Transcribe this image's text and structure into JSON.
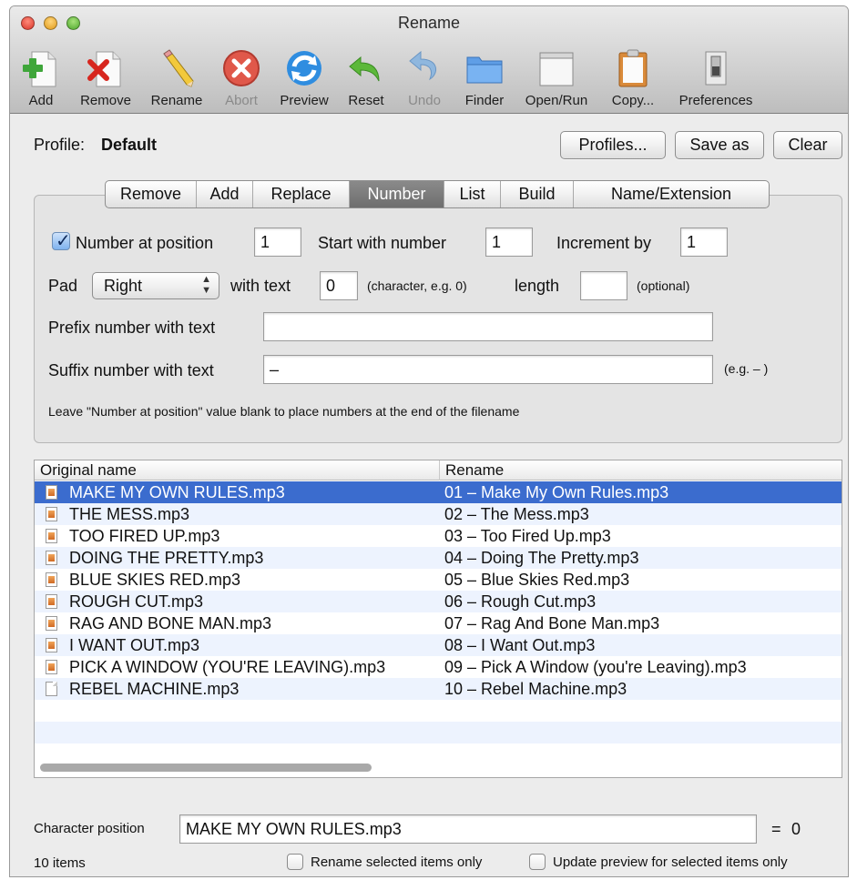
{
  "window": {
    "title": "Rename"
  },
  "toolbar": {
    "items": [
      {
        "label": "Add",
        "icon": "add-icon",
        "enabled": true
      },
      {
        "label": "Remove",
        "icon": "remove-icon",
        "enabled": true
      },
      {
        "label": "Rename",
        "icon": "pencil-icon",
        "enabled": true
      },
      {
        "label": "Abort",
        "icon": "abort-icon",
        "enabled": false
      },
      {
        "label": "Preview",
        "icon": "refresh-icon",
        "enabled": true
      },
      {
        "label": "Reset",
        "icon": "reset-arrow-icon",
        "enabled": true
      },
      {
        "label": "Undo",
        "icon": "undo-arrow-icon",
        "enabled": false
      },
      {
        "label": "Finder",
        "icon": "folder-icon",
        "enabled": true
      },
      {
        "label": "Open/Run",
        "icon": "window-icon",
        "enabled": true
      },
      {
        "label": "Copy...",
        "icon": "clipboard-icon",
        "enabled": true
      },
      {
        "label": "Preferences",
        "icon": "switch-icon",
        "enabled": true
      }
    ]
  },
  "profile": {
    "label": "Profile:",
    "name": "Default",
    "buttons": {
      "profiles": "Profiles...",
      "save_as": "Save as",
      "clear": "Clear"
    }
  },
  "tabs": [
    {
      "label": "Remove",
      "active": false
    },
    {
      "label": "Add",
      "active": false
    },
    {
      "label": "Replace",
      "active": false
    },
    {
      "label": "Number",
      "active": true
    },
    {
      "label": "List",
      "active": false
    },
    {
      "label": "Build",
      "active": false
    },
    {
      "label": "Name/Extension",
      "active": false
    }
  ],
  "number_tab": {
    "number_at_position": {
      "label": "Number at position",
      "checked": true,
      "value": "1"
    },
    "start_with": {
      "label": "Start with number",
      "value": "1"
    },
    "increment_by": {
      "label": "Increment by",
      "value": "1"
    },
    "pad": {
      "label": "Pad",
      "value": "Right"
    },
    "with_text": {
      "label": "with text",
      "value": "0",
      "hint": "(character, e.g. 0)"
    },
    "length": {
      "label": "length",
      "value": "",
      "hint": "(optional)"
    },
    "prefix": {
      "label": "Prefix number with text",
      "value": ""
    },
    "suffix": {
      "label": "Suffix number with text",
      "value": "–",
      "hint": "(e.g. – )"
    },
    "note": "Leave \"Number at position\" value blank to place numbers at the end of the filename"
  },
  "table": {
    "columns": [
      "Original name",
      "Rename"
    ],
    "rows": [
      {
        "original": "MAKE MY OWN RULES.mp3",
        "rename": "01 – Make My Own Rules.mp3",
        "icon": "mp3"
      },
      {
        "original": "THE MESS.mp3",
        "rename": "02 – The Mess.mp3",
        "icon": "mp3"
      },
      {
        "original": "TOO FIRED UP.mp3",
        "rename": "03 – Too Fired Up.mp3",
        "icon": "mp3"
      },
      {
        "original": "DOING THE PRETTY.mp3",
        "rename": "04 – Doing The Pretty.mp3",
        "icon": "mp3"
      },
      {
        "original": "BLUE SKIES RED.mp3",
        "rename": "05 – Blue Skies Red.mp3",
        "icon": "mp3"
      },
      {
        "original": "ROUGH CUT.mp3",
        "rename": "06 – Rough Cut.mp3",
        "icon": "mp3"
      },
      {
        "original": "RAG AND BONE MAN.mp3",
        "rename": "07 – Rag And Bone Man.mp3",
        "icon": "mp3"
      },
      {
        "original": "I WANT OUT.mp3",
        "rename": "08 – I Want Out.mp3",
        "icon": "mp3"
      },
      {
        "original": "PICK A WINDOW (YOU'RE LEAVING).mp3",
        "rename": "09 – Pick A Window (you're Leaving).mp3",
        "icon": "mp3"
      },
      {
        "original": "REBEL MACHINE.mp3",
        "rename": "10 – Rebel Machine.mp3",
        "icon": "plain"
      }
    ],
    "selected_index": 0
  },
  "footer": {
    "char_position_label": "Character position",
    "char_position_value": "MAKE MY OWN RULES.mp3",
    "equals": "=",
    "char_position_result": "0",
    "item_count": "10 items",
    "rename_selected": {
      "label": "Rename selected items only",
      "checked": false
    },
    "update_preview_selected": {
      "label": "Update preview for selected items only",
      "checked": false
    }
  },
  "colors": {
    "selection": "#3b6cce",
    "alt_row": "#edf3fe"
  }
}
